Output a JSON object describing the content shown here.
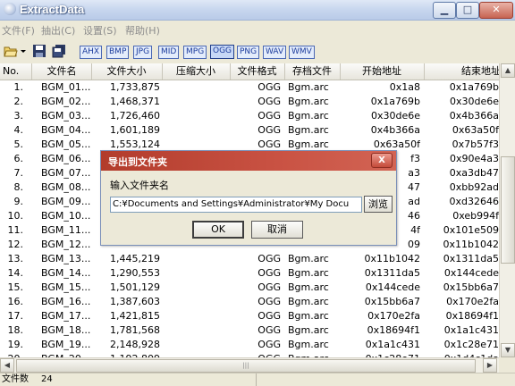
{
  "window": {
    "title": "ExtractData",
    "min": "▁",
    "max": "□",
    "close": "✕"
  },
  "menu": [
    "文件(F)",
    "抽出(C)",
    "设置(S)",
    "帮助(H)"
  ],
  "toolbar": {
    "formats": [
      "AHX",
      "BMP",
      "JPG",
      "MID",
      "MPG",
      "OGG",
      "PNG",
      "WAV",
      "WMV"
    ],
    "active": "OGG"
  },
  "columns": [
    "No.",
    "文件名",
    "文件大小",
    "压缩大小",
    "文件格式",
    "存档文件",
    "开始地址",
    "结束地址"
  ],
  "rows": [
    [
      "1.",
      "BGM_01...",
      "1,733,875",
      "",
      "OGG",
      "Bgm.arc",
      "0x1a8",
      "0x1a769b"
    ],
    [
      "2.",
      "BGM_02...",
      "1,468,371",
      "",
      "OGG",
      "Bgm.arc",
      "0x1a769b",
      "0x30de6e"
    ],
    [
      "3.",
      "BGM_03...",
      "1,726,460",
      "",
      "OGG",
      "Bgm.arc",
      "0x30de6e",
      "0x4b366a"
    ],
    [
      "4.",
      "BGM_04...",
      "1,601,189",
      "",
      "OGG",
      "Bgm.arc",
      "0x4b366a",
      "0x63a50f"
    ],
    [
      "5.",
      "BGM_05...",
      "1,553,124",
      "",
      "OGG",
      "Bgm.arc",
      "0x63a50f",
      "0x7b57f3"
    ],
    [
      "6.",
      "BGM_06...",
      "",
      "",
      "",
      "",
      "f3",
      "0x90e4a3"
    ],
    [
      "7.",
      "BGM_07...",
      "",
      "",
      "",
      "",
      "a3",
      "0xa3db47"
    ],
    [
      "8.",
      "BGM_08...",
      "",
      "",
      "",
      "",
      "47",
      "0xbb92ad"
    ],
    [
      "9.",
      "BGM_09...",
      "",
      "",
      "",
      "",
      "ad",
      "0xd32646"
    ],
    [
      "10.",
      "BGM_10...",
      "",
      "",
      "",
      "",
      "46",
      "0xeb994f"
    ],
    [
      "11.",
      "BGM_11...",
      "",
      "",
      "",
      "",
      "4f",
      "0x101e509"
    ],
    [
      "12.",
      "BGM_12...",
      "",
      "",
      "",
      "",
      "09",
      "0x11b1042"
    ],
    [
      "13.",
      "BGM_13...",
      "1,445,219",
      "",
      "OGG",
      "Bgm.arc",
      "0x11b1042",
      "0x1311da5"
    ],
    [
      "14.",
      "BGM_14...",
      "1,290,553",
      "",
      "OGG",
      "Bgm.arc",
      "0x1311da5",
      "0x144cede"
    ],
    [
      "15.",
      "BGM_15...",
      "1,501,129",
      "",
      "OGG",
      "Bgm.arc",
      "0x144cede",
      "0x15bb6a7"
    ],
    [
      "16.",
      "BGM_16...",
      "1,387,603",
      "",
      "OGG",
      "Bgm.arc",
      "0x15bb6a7",
      "0x170e2fa"
    ],
    [
      "17.",
      "BGM_17...",
      "1,421,815",
      "",
      "OGG",
      "Bgm.arc",
      "0x170e2fa",
      "0x18694f1"
    ],
    [
      "18.",
      "BGM_18...",
      "1,781,568",
      "",
      "OGG",
      "Bgm.arc",
      "0x18694f1",
      "0x1a1c431"
    ],
    [
      "19.",
      "BGM_19...",
      "2,148,928",
      "",
      "OGG",
      "Bgm.arc",
      "0x1a1c431",
      "0x1c28e71"
    ],
    [
      "20.",
      "BGM_20...",
      "1,192,809",
      "",
      "OGG",
      "Bgm.arc",
      "0x1c28e71",
      "0x1d4c1da"
    ]
  ],
  "status": {
    "label": "文件数",
    "value": "24"
  },
  "dialog": {
    "title": "导出到文件夹",
    "close": "X",
    "prompt": "输入文件夹名",
    "path": "C:¥Documents and Settings¥Administrator¥My Docu",
    "browse": "浏览",
    "ok": "OK",
    "cancel": "取消"
  }
}
